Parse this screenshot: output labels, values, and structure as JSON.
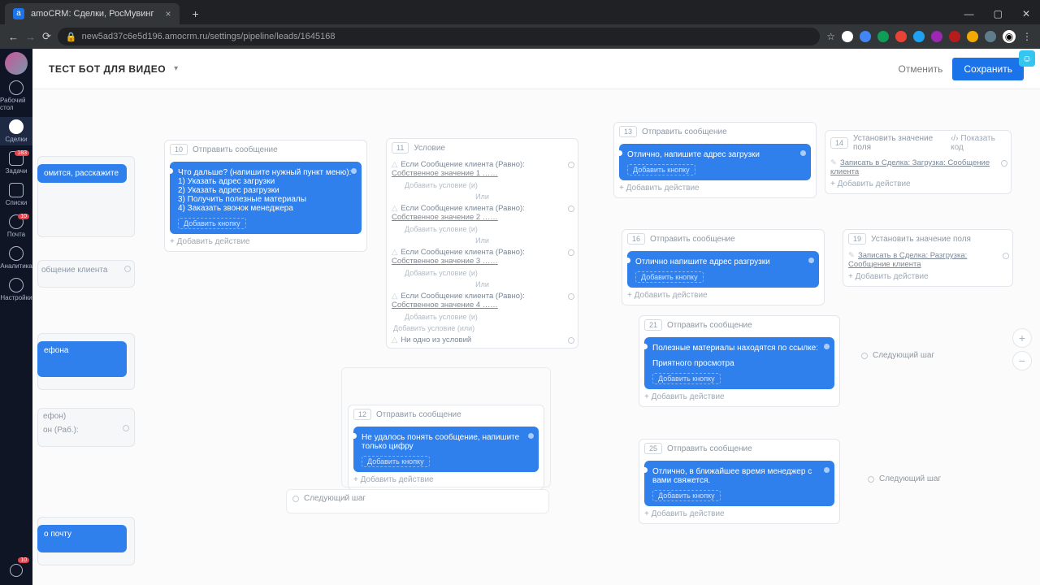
{
  "tab": {
    "title": "amoCRM: Сделки, РосМувинг"
  },
  "url": "new5ad37c6e5d196.amocrm.ru/settings/pipeline/leads/1645168",
  "sidebar": {
    "items": [
      {
        "label": "Рабочий стол"
      },
      {
        "label": "Сделки"
      },
      {
        "label": "Задачи"
      },
      {
        "label": "Списки"
      },
      {
        "label": "Почта"
      },
      {
        "label": "Аналитика"
      },
      {
        "label": "Настройки"
      }
    ],
    "badges": {
      "tasks": "183",
      "mail": "10",
      "chat": "10"
    }
  },
  "header": {
    "title": "ТЕСТ БОТ ДЛЯ ВИДЕО",
    "cancel": "Отменить",
    "save": "Сохранить"
  },
  "labels": {
    "send_msg": "Отправить сообщение",
    "condition": "Условие",
    "add_button": "Добавить кнопку",
    "add_action": "Добавить действие",
    "add_cond_and": "Добавить условие (и)",
    "add_cond_or": "Добавить условие (или)",
    "or": "Или",
    "none_cond": "Ни одно из условий",
    "set_field": "Установить значение поля",
    "show_code": "Показать код",
    "next_step": "Следующий шаг",
    "partial_intro": "омится, расскажите",
    "partial_client_msg": "общение клиента",
    "partial_phone": "ефона",
    "partial_phone_label": "ефон)",
    "partial_phone_work": "он (Раб.):",
    "partial_mail": "о почту"
  },
  "c10": {
    "num": "10",
    "l1": "Что дальше? (напишите нужный пункт меню):",
    "l2": "1) Указать адрес загрузки",
    "l3": "2) Указать адрес разгрузки",
    "l4": "3) Получить полезные материалы",
    "l5": "4) Заказать звонок менеджера"
  },
  "c11": {
    "num": "11",
    "row": "Если Сообщение клиента (Равно):",
    "v1": "Собственное значение 1 ……",
    "v2": "Собственное значение 2 ……",
    "v3": "Собственное значение 3 ……",
    "v4": "Собственное значение 4 ……"
  },
  "c12": {
    "num": "12",
    "msg": "Не удалось понять сообщение, напишите только цифру"
  },
  "c13": {
    "num": "13",
    "msg": "Отлично, напишите адрес загрузки"
  },
  "c14": {
    "num": "14",
    "msg": "Записать в Сделка: Загрузка: Сообщение клиента"
  },
  "c16": {
    "num": "16",
    "msg": "Отлично напишите адрес разгрузки"
  },
  "c19": {
    "num": "19",
    "msg": "Записать в Сделка: Разгрузка: Сообщение клиента"
  },
  "c21": {
    "num": "21",
    "l1": "Полезные материалы находятся по ссылке:",
    "l2": "Приятного просмотра"
  },
  "c25": {
    "num": "25",
    "msg": "Отлично, в ближайшее время менеджер с вами свяжется."
  }
}
